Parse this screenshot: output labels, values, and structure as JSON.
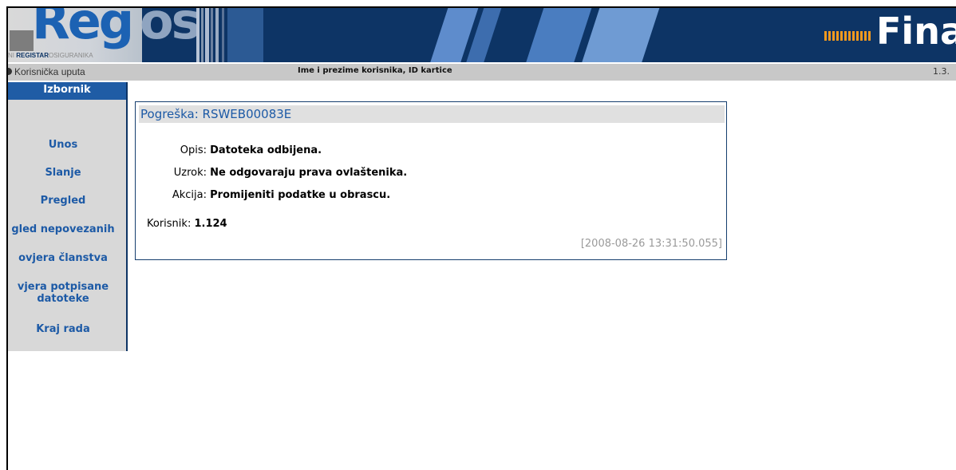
{
  "banner": {
    "logo_text": "Reg",
    "logo_tail": "os",
    "logo_sub_prefix": "NI ",
    "logo_sub_bold": "REGISTAR",
    "logo_sub_rest": "OSIGURANIKA",
    "brand_right": "Fina",
    "colors": {
      "banner_bg": "#0d3465",
      "logo_blue": "#1c62b3",
      "accent_orange": "#f29a1f"
    }
  },
  "statusbar": {
    "help_link": "Korisnička uputa",
    "user_info": "Ime i prezime korisnika, ID kartice",
    "version": "1.3."
  },
  "sidebar": {
    "title": "Izbornik",
    "items": [
      {
        "label": "Unos"
      },
      {
        "label": "Slanje"
      },
      {
        "label": "Pregled"
      },
      {
        "label": "gled nepovezanih"
      },
      {
        "label": "ovjera članstva"
      },
      {
        "label": "vjera potpisane"
      },
      {
        "label": "datoteke"
      },
      {
        "label": "Kraj rada"
      }
    ]
  },
  "error": {
    "title": "Pogreška: RSWEB00083E",
    "fields": [
      {
        "label": "Opis:",
        "value": "Datoteka odbijena."
      },
      {
        "label": "Uzrok:",
        "value": "Ne odgovaraju prava ovlaštenika."
      },
      {
        "label": "Akcija:",
        "value": "Promijeniti podatke u obrascu."
      }
    ],
    "user_label": "Korisnik:",
    "user_value": "1.124",
    "timestamp": "[2008-08-26 13:31:50.055]"
  }
}
